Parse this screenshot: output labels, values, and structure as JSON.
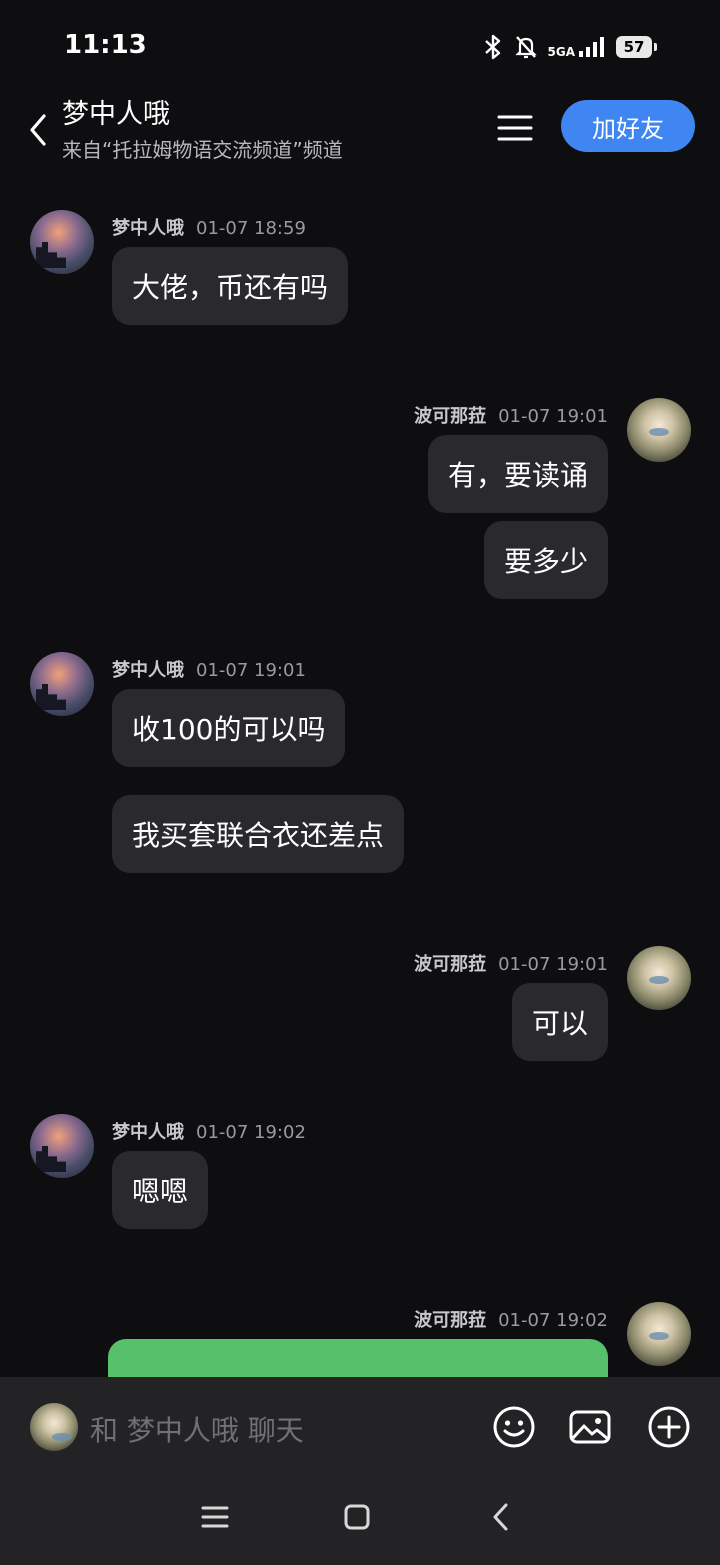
{
  "status_bar": {
    "time": "11:13",
    "network": "5GA",
    "battery": "57"
  },
  "header": {
    "title": "梦中人哦",
    "subtitle": "来自“托拉姆物语交流频道”频道",
    "add_friend_label": "加好友"
  },
  "messages": [
    {
      "side": "left",
      "sender": "梦中人哦",
      "time": "01-07 18:59",
      "bubbles": [
        "大佬，币还有吗"
      ]
    },
    {
      "side": "right",
      "sender": "波可那菈",
      "time": "01-07 19:01",
      "bubbles": [
        "有，要读诵",
        "要多少"
      ]
    },
    {
      "side": "left",
      "sender": "梦中人哦",
      "time": "01-07 19:01",
      "bubbles": [
        "收100的可以吗",
        "我买套联合衣还差点"
      ]
    },
    {
      "side": "right",
      "sender": "波可那菈",
      "time": "01-07 19:01",
      "bubbles": [
        "可以"
      ]
    },
    {
      "side": "left",
      "sender": "梦中人哦",
      "time": "01-07 19:02",
      "bubbles": [
        "嗯嗯"
      ]
    },
    {
      "side": "right",
      "sender": "波可那菈",
      "time": "01-07 19:02",
      "bubbles": []
    }
  ],
  "input": {
    "placeholder": "和 梦中人哦 聊天"
  },
  "icons": {
    "emoji": "smiley-icon",
    "image": "image-icon",
    "add": "plus-circle-icon"
  },
  "colors": {
    "accent": "#3f86f2",
    "bubble": "#2a2a2e",
    "green_card": "#56c16a"
  }
}
